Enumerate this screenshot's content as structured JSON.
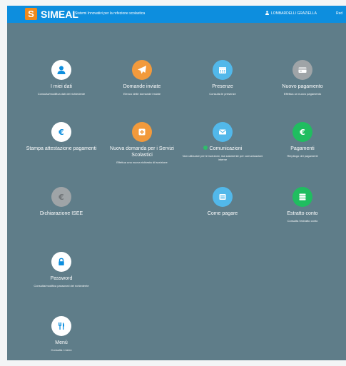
{
  "header": {
    "logo_letter": "S",
    "brand": "SIMEAL",
    "tagline": "Sistemi Innovativi per la refezione scolastica",
    "user_name": "LOMBARDELLI GRAZIELLA",
    "right_cut_text": "Red"
  },
  "colors": {
    "topbar": "#0d8ede",
    "background": "#5f7d89",
    "white": "#ffffff",
    "orange": "#f29a3c",
    "light_blue": "#52b8ea",
    "gray": "#9fa4a7",
    "green": "#20bd60"
  },
  "tiles": [
    {
      "title": "I miei dati",
      "desc": "Consulta/modifica dati del richiedente",
      "icon": "user-icon",
      "color": "#ffffff"
    },
    {
      "title": "Domande inviate",
      "desc": "Elenco delle domande inviate",
      "icon": "paper-plane-icon",
      "color": "#f29a3c"
    },
    {
      "title": "Presenze",
      "desc": "Consulta le presenze",
      "icon": "calendar-icon",
      "color": "#52b8ea"
    },
    {
      "title": "Nuovo pagamento",
      "desc": "Effettua un nuovo pagamento",
      "icon": "credit-card-icon",
      "color": "#9fa4a7"
    },
    {
      "title": "Stampa attestazione pagamenti",
      "desc": "",
      "icon": "euro-icon",
      "color": "#ffffff"
    },
    {
      "title": "Nuova domanda per i Servizi Scolastici",
      "desc": "Effettua una nuova richiesta di iscrizione",
      "icon": "plus-icon",
      "color": "#f29a3c"
    },
    {
      "title": "Comunicazioni",
      "desc": "Non utilizzare per le iscrizioni, ma solamente per comunicazioni interne",
      "icon": "envelope-icon",
      "color": "#52b8ea"
    },
    {
      "title": "Pagamenti",
      "desc": "Riepilogo dei pagamenti",
      "icon": "euro-icon",
      "color": "#20bd60"
    },
    {
      "title": "Dichiarazione ISEE",
      "desc": "",
      "icon": "euro-icon",
      "color": "#9fa4a7"
    },
    {
      "title": "Come pagare",
      "desc": "",
      "icon": "list-icon",
      "color": "#52b8ea"
    },
    {
      "title": "Estratto conto",
      "desc": "Consulta l'estratto conto",
      "icon": "statement-icon",
      "color": "#20bd60"
    },
    {
      "title": "Password",
      "desc": "Consulta/modifica password del richiedente",
      "icon": "lock-icon",
      "color": "#ffffff"
    },
    {
      "title": "Menù",
      "desc": "Consulta i menù",
      "icon": "cutlery-icon",
      "color": "#ffffff"
    }
  ]
}
